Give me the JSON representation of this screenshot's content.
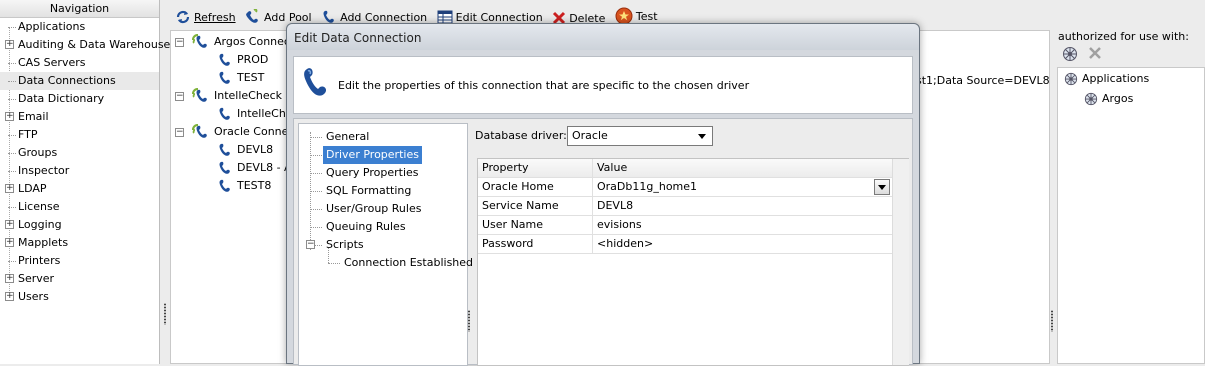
{
  "navigation": {
    "header": "Navigation",
    "items": [
      {
        "label": "Applications",
        "expandable": false
      },
      {
        "label": "Auditing & Data Warehouse",
        "expandable": true
      },
      {
        "label": "CAS Servers",
        "expandable": false
      },
      {
        "label": "Data Connections",
        "expandable": false,
        "selected": true
      },
      {
        "label": "Data Dictionary",
        "expandable": false
      },
      {
        "label": "Email",
        "expandable": true
      },
      {
        "label": "FTP",
        "expandable": false
      },
      {
        "label": "Groups",
        "expandable": false
      },
      {
        "label": "Inspector",
        "expandable": false
      },
      {
        "label": "LDAP",
        "expandable": true
      },
      {
        "label": "License",
        "expandable": false
      },
      {
        "label": "Logging",
        "expandable": true
      },
      {
        "label": "Mapplets",
        "expandable": true
      },
      {
        "label": "Printers",
        "expandable": false
      },
      {
        "label": "Server",
        "expandable": true
      },
      {
        "label": "Users",
        "expandable": true
      }
    ]
  },
  "toolbar": {
    "refresh": "Refresh",
    "add_pool": "Add Pool",
    "add_connection": "Add Connection",
    "edit_connection": "Edit Connection",
    "delete": "Delete",
    "test": "Test"
  },
  "tree": {
    "pools": [
      {
        "label": "Argos Connec",
        "children": [
          "PROD",
          "TEST"
        ]
      },
      {
        "label": "IntelleCheck C",
        "children": [
          "IntelleChe"
        ]
      },
      {
        "label": "Oracle Conne",
        "children": [
          "DEVL8",
          "DEVL8 - A",
          "TEST8"
        ]
      }
    ],
    "conn_string_fragment": "st1;Data Source=DEVL8"
  },
  "authorized": {
    "title": "authorized for use with:",
    "items": [
      {
        "label": "Applications",
        "level": 0
      },
      {
        "label": "Argos",
        "level": 1
      }
    ]
  },
  "dialog": {
    "title": "Edit Data Connection",
    "description": "Edit the properties of this connection that are specific to the chosen driver",
    "nav": [
      {
        "label": "General",
        "level": 0
      },
      {
        "label": "Driver Properties",
        "level": 0,
        "selected": true
      },
      {
        "label": "Query Properties",
        "level": 0
      },
      {
        "label": "SQL Formatting",
        "level": 0
      },
      {
        "label": "User/Group Rules",
        "level": 0
      },
      {
        "label": "Queuing Rules",
        "level": 0
      },
      {
        "label": "Scripts",
        "level": 0,
        "expandable": true
      },
      {
        "label": "Connection Established",
        "level": 1
      }
    ],
    "driver_label": "Database driver:",
    "driver_value": "Oracle",
    "props_header": {
      "property": "Property",
      "value": "Value"
    },
    "properties": [
      {
        "name": "Oracle Home",
        "value": "OraDb11g_home1",
        "combo": true
      },
      {
        "name": "Service Name",
        "value": "DEVL8"
      },
      {
        "name": "User Name",
        "value": "evisions"
      },
      {
        "name": "Password",
        "value": "<hidden>"
      }
    ]
  },
  "colors": {
    "selection": "#3b7fd1",
    "phone_icon": "#1f4f9a",
    "pool_icon": "#7fb23a",
    "delete_icon": "#cc2020",
    "test_icon": "#d9531e"
  }
}
